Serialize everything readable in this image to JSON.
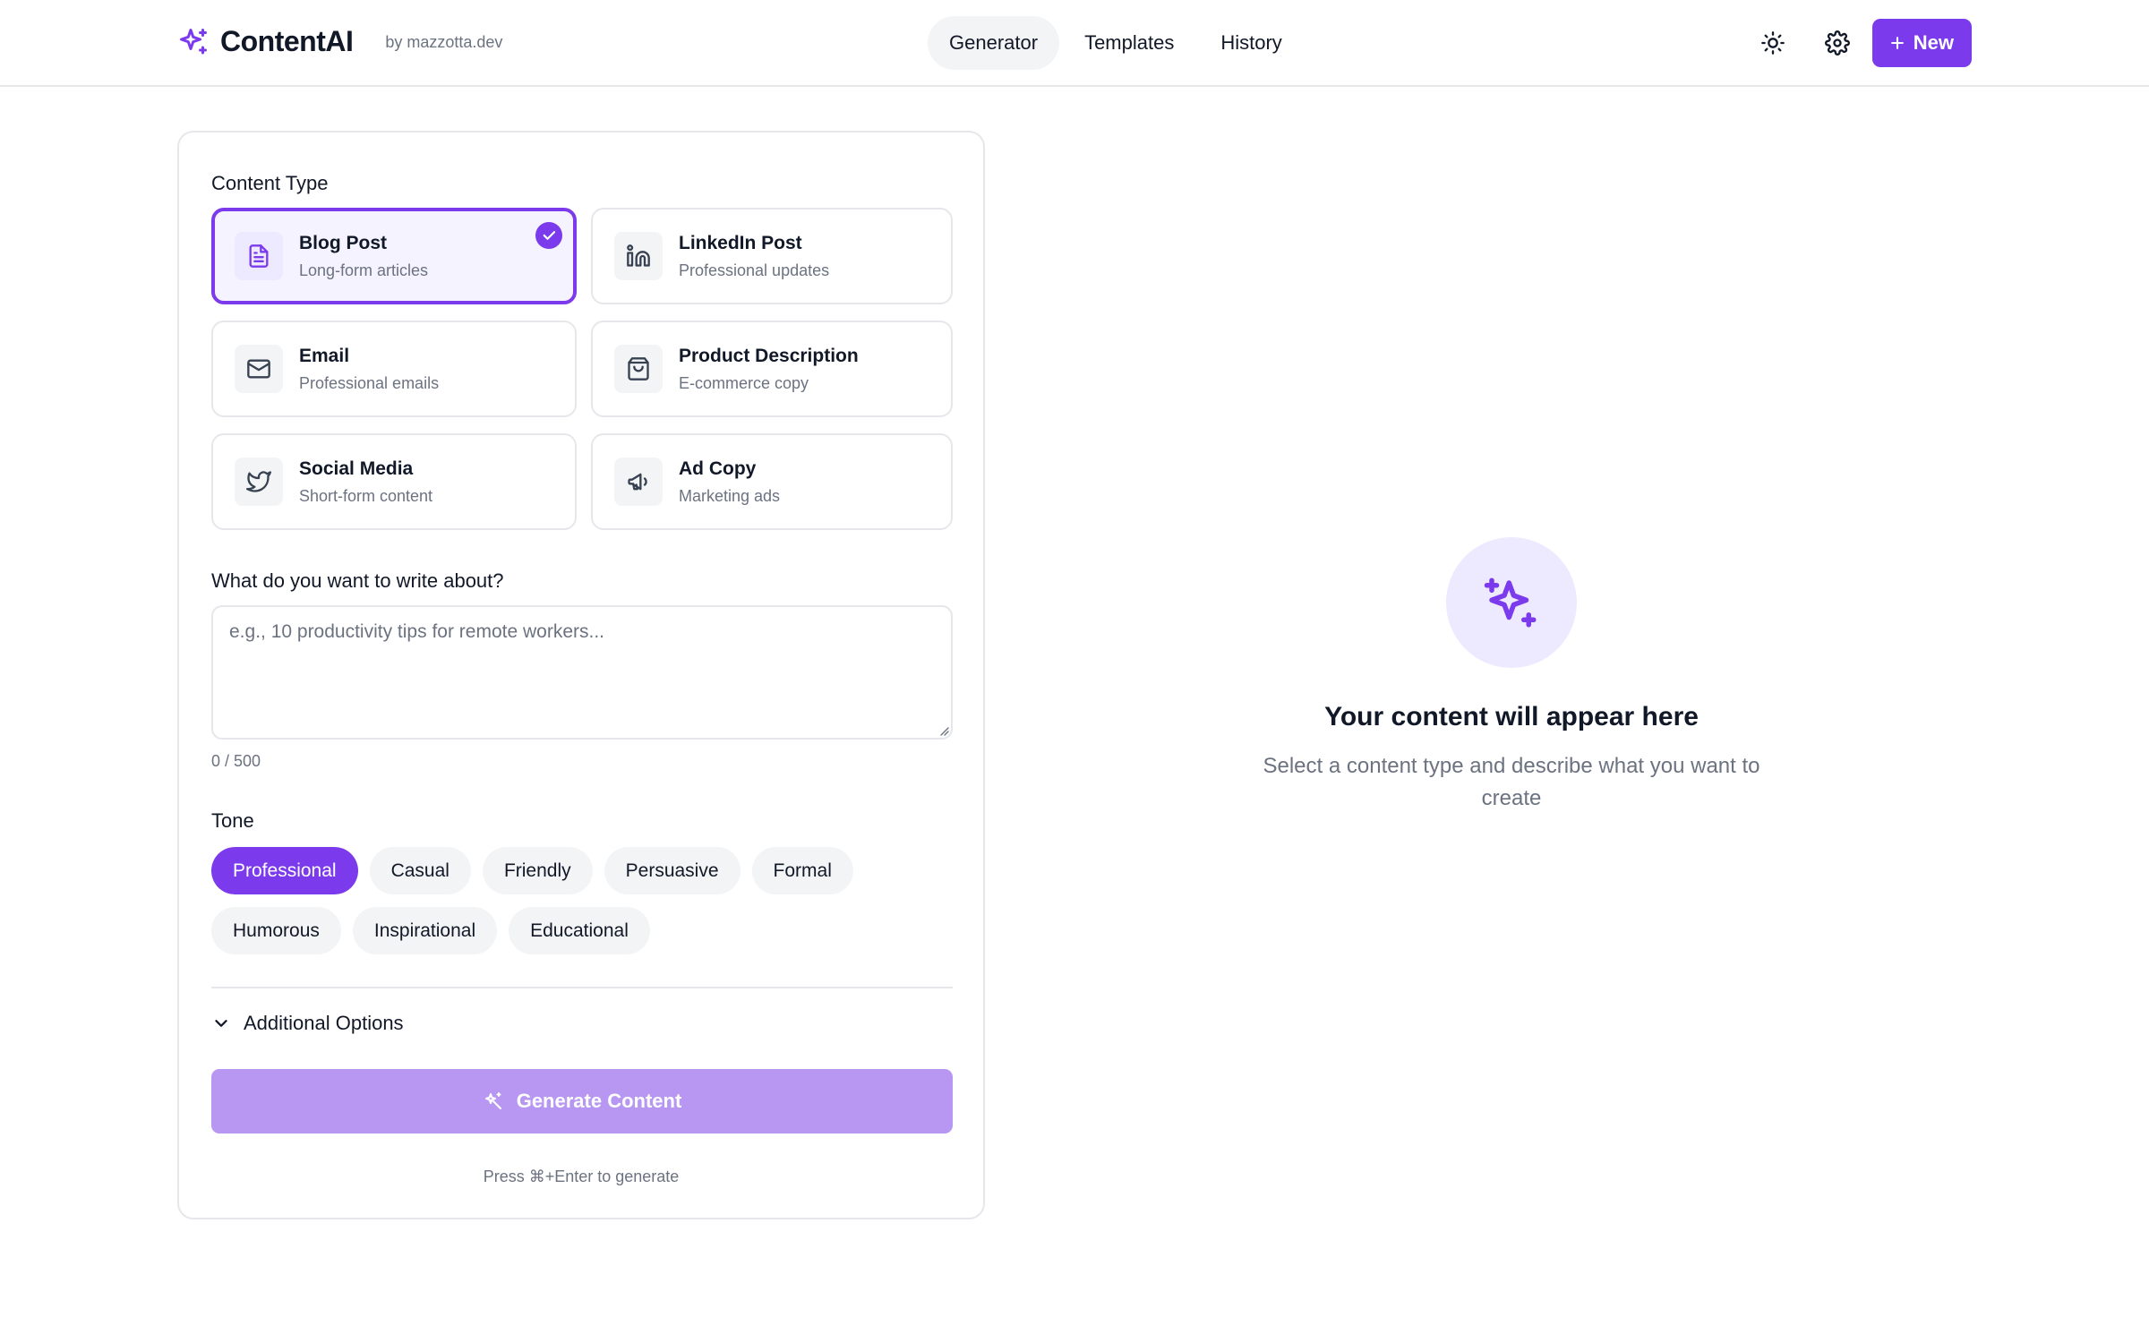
{
  "brand": {
    "name": "ContentAI",
    "by": "by mazzotta.dev",
    "icon": "sparkles-icon"
  },
  "nav": {
    "tabs": [
      {
        "label": "Generator",
        "active": true
      },
      {
        "label": "Templates",
        "active": false
      },
      {
        "label": "History",
        "active": false
      }
    ]
  },
  "header": {
    "theme_icon": "sun-icon",
    "settings_icon": "gear-icon",
    "new_label": "New"
  },
  "form": {
    "content_type_label": "Content Type",
    "types": [
      {
        "title": "Blog Post",
        "desc": "Long-form articles",
        "icon": "document-icon",
        "selected": true
      },
      {
        "title": "LinkedIn Post",
        "desc": "Professional updates",
        "icon": "linkedin-icon",
        "selected": false
      },
      {
        "title": "Email",
        "desc": "Professional emails",
        "icon": "mail-icon",
        "selected": false
      },
      {
        "title": "Product Description",
        "desc": "E-commerce copy",
        "icon": "shopping-bag-icon",
        "selected": false
      },
      {
        "title": "Social Media",
        "desc": "Short-form content",
        "icon": "twitter-icon",
        "selected": false
      },
      {
        "title": "Ad Copy",
        "desc": "Marketing ads",
        "icon": "megaphone-icon",
        "selected": false
      }
    ],
    "topic_label": "What do you want to write about?",
    "topic_value": "",
    "topic_placeholder": "e.g., 10 productivity tips for remote workers...",
    "char_count": "0 / 500",
    "tone_label": "Tone",
    "tones": [
      {
        "label": "Professional",
        "active": true
      },
      {
        "label": "Casual",
        "active": false
      },
      {
        "label": "Friendly",
        "active": false
      },
      {
        "label": "Persuasive",
        "active": false
      },
      {
        "label": "Formal",
        "active": false
      },
      {
        "label": "Humorous",
        "active": false
      },
      {
        "label": "Inspirational",
        "active": false
      },
      {
        "label": "Educational",
        "active": false
      }
    ],
    "additional_options_label": "Additional Options",
    "generate_label": "Generate Content",
    "hint": "Press ⌘+Enter to generate"
  },
  "empty_state": {
    "title": "Your content will appear here",
    "subtitle": "Select a content type and describe what you want to create"
  },
  "colors": {
    "accent": "#7c3aed",
    "accent_light": "#ede9fe",
    "accent_disabled": "#b897f2",
    "muted_text": "#6b7280",
    "border": "#e5e7eb"
  }
}
